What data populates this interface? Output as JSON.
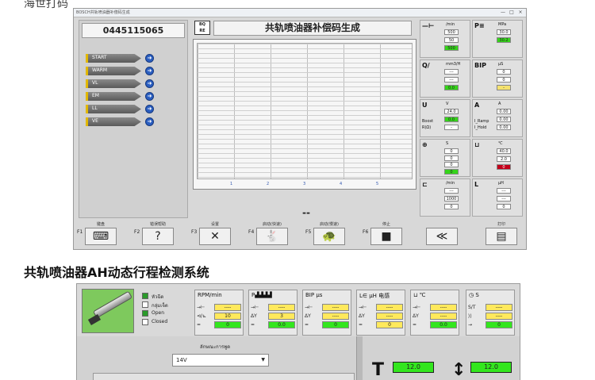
{
  "caption": "海世打码",
  "window1": {
    "title": "BOSCH共轨喷油器补偿码生成",
    "controls": [
      "—",
      "□",
      "×"
    ],
    "part_number": "0445115065",
    "stages": [
      "START",
      "WARM",
      "VL",
      "EM",
      "LL",
      "VE"
    ],
    "logo": [
      "BQ",
      "RE"
    ],
    "header_title": "共轨喷油器补偿码生成",
    "chart_ticks": [
      "1",
      "2",
      "3",
      "4",
      "5"
    ],
    "dash": "--",
    "gauges": [
      {
        "icon": "—⊢",
        "unit": "/min",
        "values": [
          "500",
          "50",
          "500"
        ],
        "colors": [
          "",
          "",
          "green"
        ]
      },
      {
        "icon": "P≡",
        "unit": "MPa",
        "values": [
          "30.0",
          "30.2"
        ],
        "colors": [
          "",
          "green"
        ]
      },
      {
        "icon": "Q/",
        "unit": "mm3/H",
        "values": [
          "---",
          "---",
          "0.0"
        ],
        "colors": [
          "",
          "",
          "green"
        ]
      },
      {
        "icon": "BIP",
        "unit": "μS",
        "values": [
          "0",
          "0",
          "-"
        ],
        "colors": [
          "",
          "",
          "yellow"
        ]
      },
      {
        "icon": "U",
        "unit": "V",
        "label": "Boost",
        "label2": "R(Ω)",
        "values": [
          "24.0",
          "0.0",
          "-"
        ],
        "colors": [
          "",
          "green",
          ""
        ]
      },
      {
        "icon": "A",
        "unit": "A",
        "label": "I_Ramp",
        "label2": "I_Hold",
        "values": [
          "0.00",
          "0.00",
          "0.00"
        ],
        "colors": [
          "",
          "",
          ""
        ]
      },
      {
        "icon": "⊕",
        "unit": "S",
        "values": [
          "0",
          "0",
          "0",
          "0"
        ],
        "colors": [
          "",
          "",
          "",
          "green"
        ]
      },
      {
        "icon": "⊔",
        "unit": "℃",
        "values": [
          "40.0",
          "2.0",
          "0"
        ],
        "colors": [
          "",
          "",
          "red"
        ]
      },
      {
        "icon": "⊏",
        "unit": "/min",
        "values": [
          "---",
          "1000",
          "0"
        ],
        "colors": [
          "",
          "",
          ""
        ]
      },
      {
        "icon": "L",
        "unit": "μH",
        "values": [
          "---",
          "---",
          "0"
        ],
        "colors": [
          "",
          "",
          ""
        ]
      }
    ],
    "fkeys": [
      {
        "num": "F1",
        "label": "键盘",
        "icon": "⌨"
      },
      {
        "num": "F2",
        "label": "错误帮助",
        "icon": "?"
      },
      {
        "num": "F3",
        "label": "设置",
        "icon": "✕"
      },
      {
        "num": "F4",
        "label": "启动(快速)",
        "icon": "🐇"
      },
      {
        "num": "F5",
        "label": "启动(慢速)",
        "icon": "🐢"
      },
      {
        "num": "F6",
        "label": "停止",
        "icon": "■"
      },
      {
        "num": "",
        "label": "",
        "icon": "≪"
      },
      {
        "num": "",
        "label": "打印",
        "icon": "▤"
      }
    ]
  },
  "section_heading": "共轨喷油器AH动态行程检测系统",
  "window2": {
    "checks": [
      {
        "label": "หัวฉีด",
        "checked": true
      },
      {
        "label": "กลุ่มเจ็ต",
        "checked": false
      },
      {
        "label": "Open",
        "checked": true
      },
      {
        "label": "Closed",
        "checked": false
      }
    ],
    "meters": [
      {
        "title": "RPM/min",
        "rows": [
          [
            "→⊢",
            "----",
            "yellow"
          ],
          [
            "⊲/⊾",
            "10",
            "yellow"
          ],
          [
            "=",
            "0",
            "green"
          ]
        ]
      },
      {
        "title": "P▟▟▟▟",
        "rows": [
          [
            "→⊢",
            "----",
            "yellow"
          ],
          [
            "ΔY",
            "3",
            "yellow"
          ],
          [
            "=",
            "0.0",
            "green"
          ]
        ]
      },
      {
        "title": "BIP μs",
        "rows": [
          [
            "→⊢",
            "----",
            "yellow"
          ],
          [
            "ΔY",
            "----",
            "yellow"
          ],
          [
            "=",
            "0",
            "green"
          ]
        ]
      },
      {
        "title": "L∈ μH 电感",
        "rows": [
          [
            "→⊢",
            "----",
            "yellow"
          ],
          [
            "ΔY",
            "----",
            "yellow"
          ],
          [
            "=",
            "0",
            "yellow"
          ]
        ]
      },
      {
        "title": "⊔ ℃",
        "rows": [
          [
            "→⊢",
            "----",
            "yellow"
          ],
          [
            "ΔY",
            "----",
            "yellow"
          ],
          [
            "=",
            "0.0",
            "green"
          ]
        ]
      },
      {
        "title": "◷ S",
        "rows": [
          [
            "S/T",
            "----",
            "yellow"
          ],
          [
            "⟩⟩",
            "----",
            "yellow"
          ],
          [
            "→",
            "0",
            "green"
          ]
        ]
      }
    ],
    "voltage_caption": "ลักษณะการพูด",
    "voltage_value": "14V",
    "readout_left": "12.0",
    "readout_right": "12.0"
  }
}
